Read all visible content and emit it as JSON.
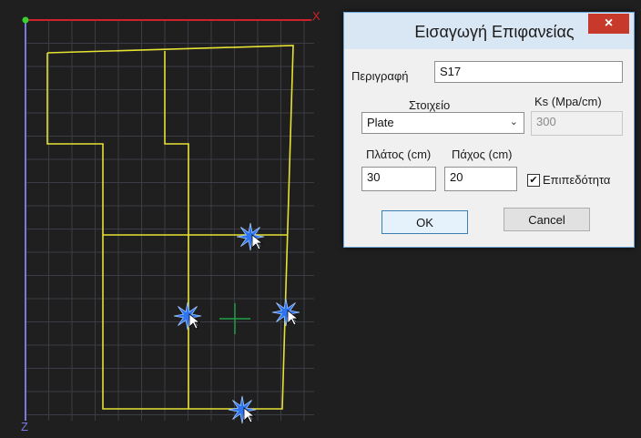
{
  "viewport": {
    "axis_x_label": "X",
    "axis_z_label": "Z",
    "colors": {
      "background": "#1f1f1f",
      "grid": "#3a3d45",
      "outline": "#e6e234",
      "x_axis": "#d0202a",
      "z_axis": "#7b78e0",
      "origin": "#36d12c",
      "crosshair": "#1fa044",
      "snap_marker": "#2f74ef"
    },
    "snap_markers": [
      "star-marker",
      "star-marker",
      "star-marker",
      "star-marker"
    ],
    "cursor_icon": "arrow-cursor-icon"
  },
  "dialog": {
    "title": "Εισαγωγή Επιφανείας",
    "close_label": "×",
    "description_label": "Περιγραφή",
    "description_value": "S17",
    "element_label": "Στοιχείο",
    "element_value": "Plate",
    "ks_label": "Ks (Mpa/cm)",
    "ks_value": "300",
    "width_label": "Πλάτος (cm)",
    "width_value": "30",
    "thickness_label": "Πάχος (cm)",
    "thickness_value": "20",
    "planar_label": "Επιπεδότητα",
    "planar_checked": "✔",
    "ok_label": "OK",
    "cancel_label": "Cancel"
  }
}
